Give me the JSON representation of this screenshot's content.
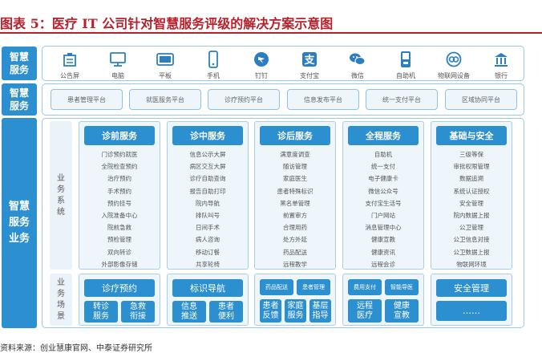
{
  "title": "图表 5：医疗 IT 公司针对智慧服务评级的解决方案示意图",
  "rows": {
    "terminal": "智慧服务",
    "platform": "智慧服务",
    "business": "智慧服务业务"
  },
  "devices": [
    {
      "label": "公告屏",
      "icon": "notice-board-icon"
    },
    {
      "label": "电脑",
      "icon": "computer-icon"
    },
    {
      "label": "平板",
      "icon": "tablet-icon"
    },
    {
      "label": "手机",
      "icon": "mobile-phone-icon"
    },
    {
      "label": "钉钉",
      "icon": "dingtalk-icon"
    },
    {
      "label": "支付宝",
      "icon": "alipay-icon"
    },
    {
      "label": "微信",
      "icon": "wechat-icon"
    },
    {
      "label": "自助机",
      "icon": "kiosk-icon"
    },
    {
      "label": "物联网设备",
      "icon": "iot-icon"
    },
    {
      "label": "银行",
      "icon": "bank-icon"
    }
  ],
  "platforms": [
    "患者管理平台",
    "就医服务平台",
    "诊疗预约平台",
    "信息发布平台",
    "统一支付平台",
    "区域协同平台"
  ],
  "labels": {
    "system": "业务系统",
    "scene": "业务场景"
  },
  "columns": [
    {
      "title": "诊前服务",
      "items": [
        "门诊预约就医",
        "全院检查预约",
        "治疗预约",
        "手术预约",
        "预约挂号",
        "入院准备中心",
        "院前急救",
        "预检管理",
        "双向转诊",
        "外部影像存储"
      ]
    },
    {
      "title": "诊中服务",
      "items": [
        "信息公示大屏",
        "病区交互大屏",
        "诊疗自助查询",
        "报告自助打印",
        "院内导航",
        "排队叫号",
        "日间手术",
        "病人咨询",
        "移动订餐",
        "共享轮椅"
      ]
    },
    {
      "title": "诊后服务",
      "items": [
        "满意度调查",
        "随访管理",
        "家庭医生",
        "患者特殊标识",
        "黑名单管理",
        "前置审方",
        "合理用药",
        "处方外延",
        "药品配送",
        "远程教学"
      ]
    },
    {
      "title": "全程服务",
      "items": [
        "自助机",
        "统一支付",
        "电子健康卡",
        "微信公众号",
        "支付宝生活号",
        "门户网站",
        "消息管理中心",
        "健康宣教",
        "健康资讯",
        "远程会诊"
      ]
    },
    {
      "title": "基础与安全",
      "items": [
        "三级等保",
        "审批权限管理",
        "数据追溯",
        "系统认证授权",
        "安全管理",
        "院内数据上报",
        "公卫管理",
        "公卫信息对接",
        "公卫数据上报",
        "物联网环境"
      ]
    }
  ],
  "scenes": {
    "c1": {
      "main": "诊疗预约",
      "a": "转诊服务",
      "b": "急救衔接"
    },
    "c2": {
      "main": "标识导航",
      "a": "信息推送",
      "b": "患者便利"
    },
    "c3": {
      "top_a": "药品配送",
      "top_b": "患者管理",
      "a": "患者反馈",
      "b": "家庭服务",
      "c": "基层指导"
    },
    "c4": {
      "top_a": "费用支付",
      "top_b": "智能导医",
      "a": "远程医疗",
      "b": "健康宣教"
    },
    "c5": {
      "main": "安全管理",
      "more": "……"
    }
  },
  "source": "资料来源：创业慧康官网、中泰证券研究所",
  "colors": {
    "accent": "#2b8fd0",
    "title": "#b8202a",
    "panel_border": "#9cc8e8"
  }
}
